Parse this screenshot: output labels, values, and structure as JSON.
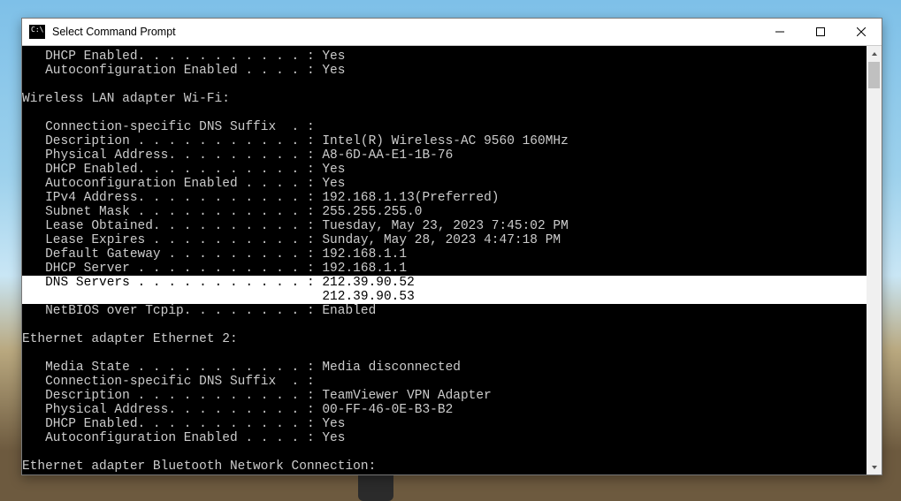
{
  "window": {
    "title": "Select Command Prompt"
  },
  "lines": {
    "l0": "   DHCP Enabled. . . . . . . . . . . : Yes",
    "l1": "   Autoconfiguration Enabled . . . . : Yes",
    "l2": "",
    "l3": "Wireless LAN adapter Wi-Fi:",
    "l4": "",
    "l5": "   Connection-specific DNS Suffix  . :",
    "l6": "   Description . . . . . . . . . . . : Intel(R) Wireless-AC 9560 160MHz",
    "l7": "   Physical Address. . . . . . . . . : A8-6D-AA-E1-1B-76",
    "l8": "   DHCP Enabled. . . . . . . . . . . : Yes",
    "l9": "   Autoconfiguration Enabled . . . . : Yes",
    "l10": "   IPv4 Address. . . . . . . . . . . : 192.168.1.13(Preferred)",
    "l11": "   Subnet Mask . . . . . . . . . . . : 255.255.255.0",
    "l12": "   Lease Obtained. . . . . . . . . . : Tuesday, May 23, 2023 7:45:02 PM",
    "l13": "   Lease Expires . . . . . . . . . . : Sunday, May 28, 2023 4:47:18 PM",
    "l14": "   Default Gateway . . . . . . . . . : 192.168.1.1",
    "l15": "   DHCP Server . . . . . . . . . . . : 192.168.1.1",
    "l16": "   DNS Servers . . . . . . . . . . . : 212.39.90.52                                                                                                              ",
    "l17": "                                       212.39.90.53                                                                                                              ",
    "l18": "   NetBIOS over Tcpip. . . . . . . . : Enabled",
    "l19": "",
    "l20": "Ethernet adapter Ethernet 2:",
    "l21": "",
    "l22": "   Media State . . . . . . . . . . . : Media disconnected",
    "l23": "   Connection-specific DNS Suffix  . :",
    "l24": "   Description . . . . . . . . . . . : TeamViewer VPN Adapter",
    "l25": "   Physical Address. . . . . . . . . : 00-FF-46-0E-B3-B2",
    "l26": "   DHCP Enabled. . . . . . . . . . . : Yes",
    "l27": "   Autoconfiguration Enabled . . . . : Yes",
    "l28": "",
    "l29": "Ethernet adapter Bluetooth Network Connection:"
  }
}
